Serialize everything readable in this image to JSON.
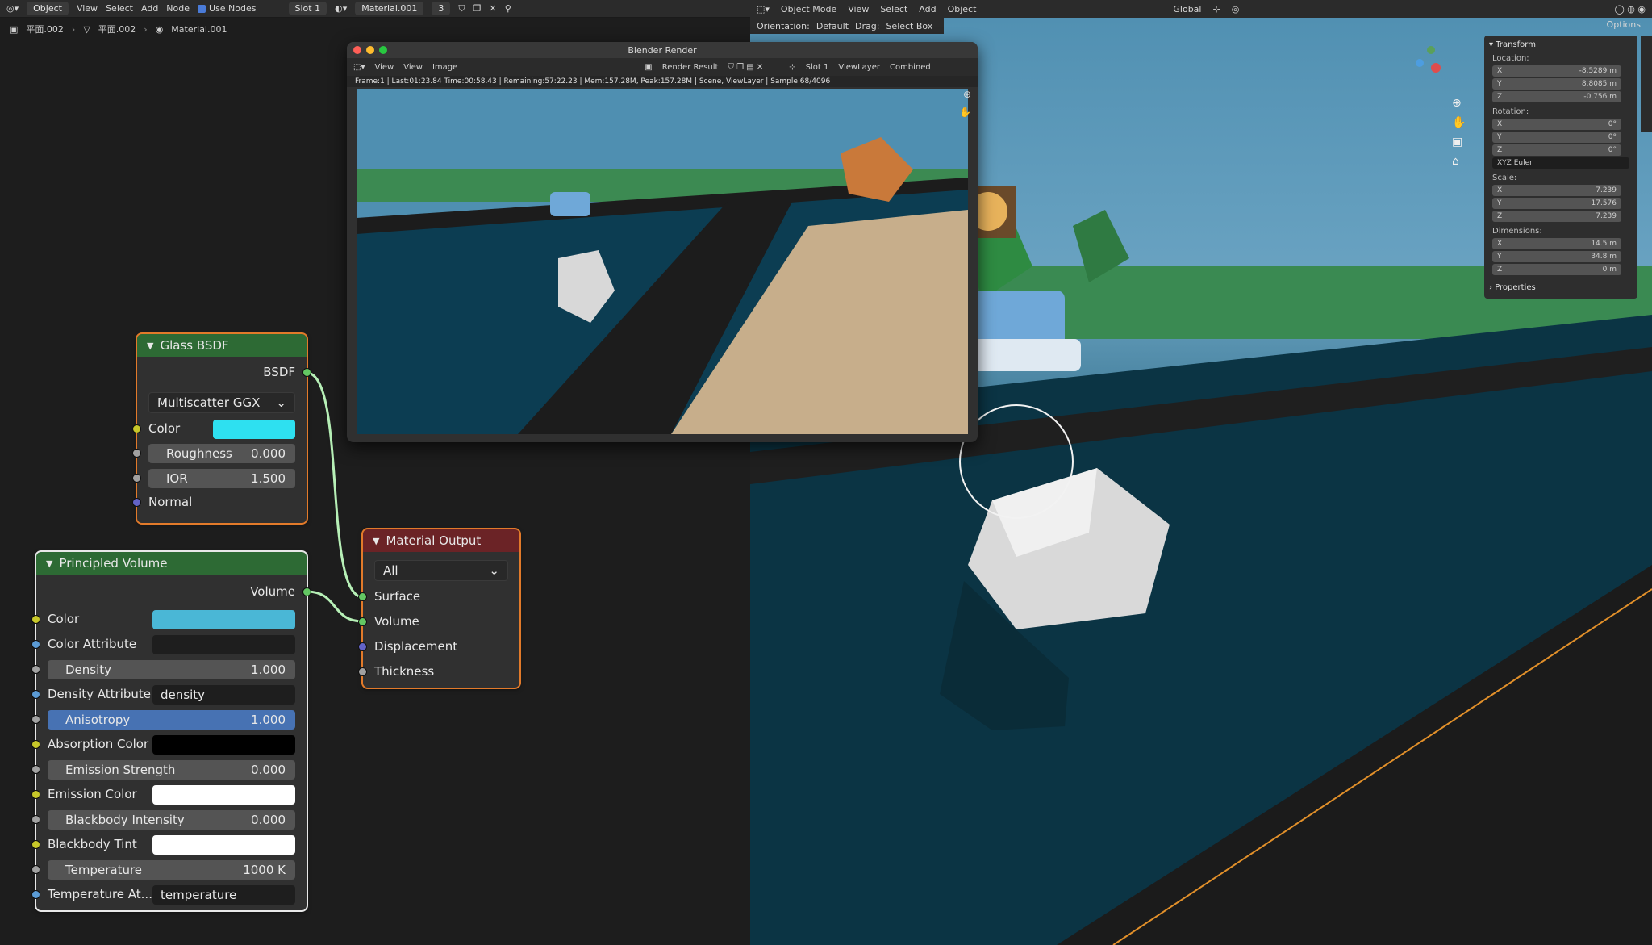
{
  "editor_header": {
    "mode": "Object",
    "menus": [
      "View",
      "Select",
      "Add",
      "Node"
    ],
    "use_nodes_label": "Use Nodes",
    "slot": "Slot 1",
    "material": "Material.001",
    "user_count": "3"
  },
  "breadcrumbs": [
    "平面.002",
    "平面.002",
    "Material.001"
  ],
  "viewport_header": {
    "mode": "Object Mode",
    "menus": [
      "View",
      "Select",
      "Add",
      "Object"
    ],
    "transform_space": "Global",
    "orientation_label": "Orientation:",
    "orientation_value": "Default",
    "drag_label": "Drag:",
    "drag_value": "Select Box",
    "options": "Options"
  },
  "glass_node": {
    "title": "Glass BSDF",
    "output": "BSDF",
    "distribution": "Multiscatter GGX",
    "color_label": "Color",
    "color": "#2ee0f0",
    "roughness_label": "Roughness",
    "roughness": "0.000",
    "ior_label": "IOR",
    "ior": "1.500",
    "normal_label": "Normal"
  },
  "volume_node": {
    "title": "Principled Volume",
    "output": "Volume",
    "color_label": "Color",
    "color": "#4ab7d6",
    "color_attr_label": "Color Attribute",
    "density_label": "Density",
    "density": "1.000",
    "density_attr_label": "Density Attribute",
    "density_attr": "density",
    "anisotropy_label": "Anisotropy",
    "anisotropy": "1.000",
    "absorption_label": "Absorption Color",
    "absorption_color": "#000000",
    "emission_strength_label": "Emission Strength",
    "emission_strength": "0.000",
    "emission_color_label": "Emission Color",
    "emission_color": "#ffffff",
    "blackbody_label": "Blackbody Intensity",
    "blackbody": "0.000",
    "blackbody_tint_label": "Blackbody Tint",
    "blackbody_tint": "#ffffff",
    "temperature_label": "Temperature",
    "temperature": "1000 K",
    "temp_attr_label": "Temperature At...",
    "temp_attr": "temperature"
  },
  "output_node": {
    "title": "Material Output",
    "target": "All",
    "inputs": [
      "Surface",
      "Volume",
      "Displacement",
      "Thickness"
    ]
  },
  "render_window": {
    "title": "Blender Render",
    "menus": [
      "View",
      "View",
      "Image"
    ],
    "image": "Render Result",
    "slot": "Slot 1",
    "layer": "ViewLayer",
    "pass": "Combined",
    "info": "Frame:1 | Last:01:23.84 Time:00:58.43 | Remaining:57:22.23 | Mem:157.28M, Peak:157.28M | Scene, ViewLayer | Sample 68/4096"
  },
  "transform_panel": {
    "title": "Transform",
    "location_label": "Location:",
    "location": [
      [
        "X",
        "-8.5289 m"
      ],
      [
        "Y",
        "8.8085 m"
      ],
      [
        "Z",
        "-0.756 m"
      ]
    ],
    "rotation_label": "Rotation:",
    "rotation": [
      [
        "X",
        "0°"
      ],
      [
        "Y",
        "0°"
      ],
      [
        "Z",
        "0°"
      ]
    ],
    "rotation_mode": "XYZ Euler",
    "scale_label": "Scale:",
    "scale": [
      [
        "X",
        "7.239"
      ],
      [
        "Y",
        "17.576"
      ],
      [
        "Z",
        "7.239"
      ]
    ],
    "dimensions_label": "Dimensions:",
    "dimensions": [
      [
        "X",
        "14.5 m"
      ],
      [
        "Y",
        "34.8 m"
      ],
      [
        "Z",
        "0 m"
      ]
    ],
    "properties": "Properties"
  },
  "colors": {
    "accent_select": "#e27a2a",
    "shader_header": "#2d6a34",
    "output_header": "#6b2326",
    "field_active": "#4772b3"
  }
}
